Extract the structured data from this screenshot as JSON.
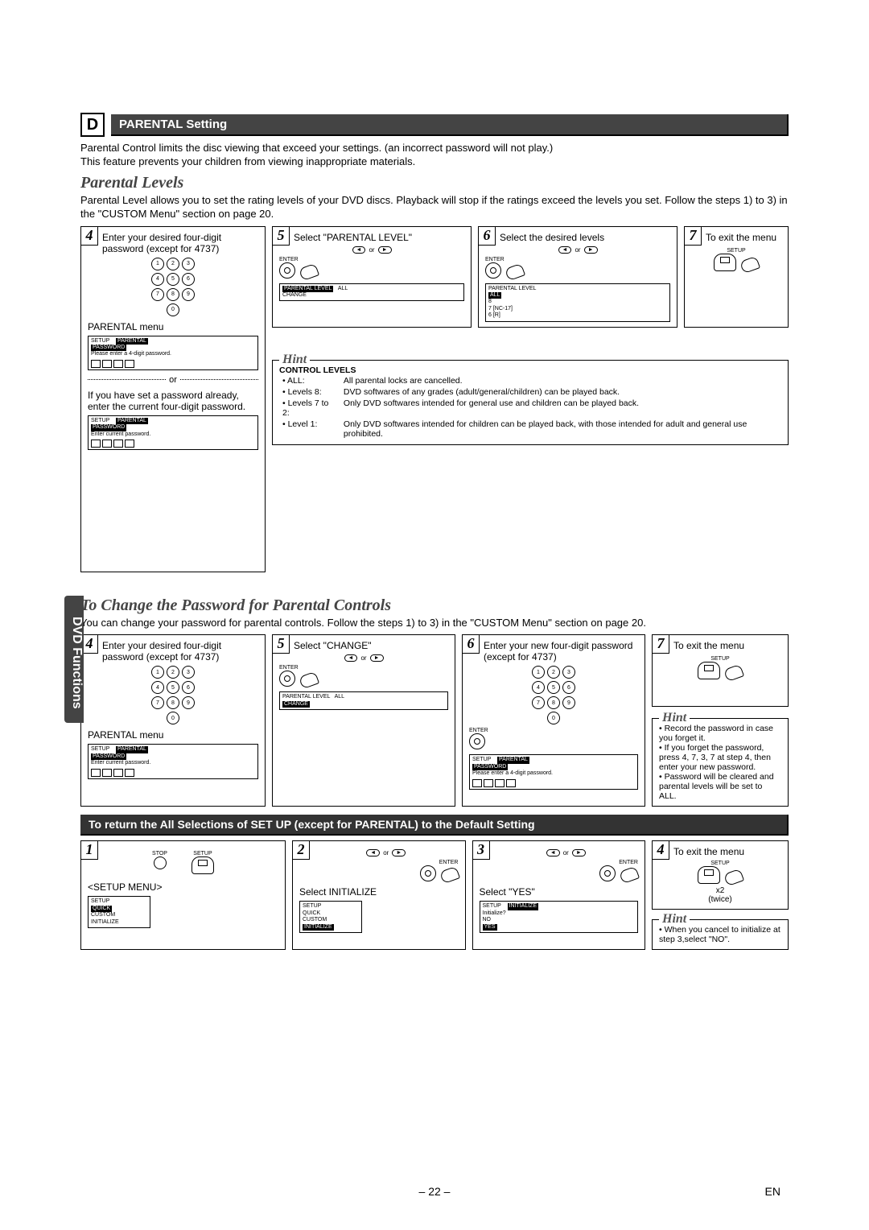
{
  "section": {
    "letter": "D",
    "title": "PARENTAL Setting"
  },
  "intro1": "Parental Control limits the disc viewing that exceed your settings. (an incorrect password will not play.)",
  "intro2": "This feature prevents your children from viewing inappropriate materials.",
  "sub1": "Parental Levels",
  "sub1_desc": "Parental Level allows you to set the rating levels of your DVD discs. Playback will stop if the ratings exceed the levels you set. Follow the steps 1) to 3) in the \"CUSTOM Menu\" section on page 20.",
  "step4": {
    "num": "4",
    "text": "Enter your desired four-digit password (except for 4737)",
    "menu_label": "PARENTAL menu",
    "osd": {
      "setup": "SETUP",
      "parental": "PARENTAL",
      "password": "PASSWORD",
      "prompt": "Please enter a 4-digit password."
    },
    "or": "or",
    "if_set": "If you have set a password already, enter the current four-digit password.",
    "osd2_prompt": "Enter current password."
  },
  "step5": {
    "num": "5",
    "text": "Select \"PARENTAL LEVEL\"",
    "or": "or",
    "osd": {
      "level": "PARENTAL LEVEL",
      "all": "ALL",
      "change": "CHANGE"
    }
  },
  "step6": {
    "num": "6",
    "text": "Select the desired levels",
    "or": "or",
    "osd": {
      "level": "PARENTAL LEVEL",
      "all": "ALL",
      "l8": "8",
      "l7": "7 [NC-17]",
      "l6": "6 [R]"
    }
  },
  "step7": {
    "num": "7",
    "text": "To exit the menu",
    "setup_lbl": "SETUP"
  },
  "hint1": {
    "title": "Hint",
    "heading": "CONTROL LEVELS",
    "rows": [
      {
        "lbl": "• ALL:",
        "desc": "All parental locks are cancelled."
      },
      {
        "lbl": "• Levels 8:",
        "desc": "DVD softwares of any grades (adult/general/children) can be played back."
      },
      {
        "lbl": "• Levels 7 to 2:",
        "desc": "Only DVD softwares intended for general use and children can be played back."
      },
      {
        "lbl": "• Level 1:",
        "desc": "Only DVD softwares intended for children can be played back, with those intended for adult and general use prohibited."
      }
    ]
  },
  "sub2": "To Change the Password for Parental Controls",
  "sub2_desc": "You can change your password for parental controls.  Follow the steps 1) to 3) in the \"CUSTOM Menu\" section on page 20.",
  "c_step4": {
    "num": "4",
    "text": "Enter your desired four-digit password (except for 4737)",
    "menu_label": "PARENTAL menu",
    "osd": {
      "setup": "SETUP",
      "parental": "PARENTAL",
      "password": "PASSWORD",
      "prompt": "Enter current password."
    }
  },
  "c_step5": {
    "num": "5",
    "text": "Select \"CHANGE\"",
    "or": "or",
    "osd": {
      "level": "PARENTAL LEVEL",
      "all": "ALL",
      "change": "CHANGE"
    }
  },
  "c_step6": {
    "num": "6",
    "text": "Enter your new four-digit password (except for 4737)",
    "osd": {
      "setup": "SETUP",
      "parental": "PARENTAL",
      "password": "PASSWORD",
      "prompt": "Please enter a 4-digit password."
    }
  },
  "c_step7": {
    "num": "7",
    "text": "To exit the menu",
    "setup_lbl": "SETUP"
  },
  "hint2": {
    "title": "Hint",
    "items": [
      "Record the password in case you forget it.",
      "If you forget the password, press 4, 7, 3, 7 at step 4, then enter your new password.",
      "Password will be cleared and parental levels will be set to ALL."
    ]
  },
  "return_bar": "To return the All Selections of SET UP (except for PARENTAL) to the Default Setting",
  "r_step1": {
    "num": "1",
    "setup_menu": "<SETUP MENU>",
    "stop": "STOP",
    "setup": "SETUP",
    "osd": {
      "setup": "SETUP",
      "quick": "QUICK",
      "custom": "CUSTOM",
      "init": "INITIALIZE"
    }
  },
  "r_step2": {
    "num": "2",
    "or": "or",
    "select": "Select INITIALIZE",
    "osd": {
      "setup": "SETUP",
      "quick": "QUICK",
      "custom": "CUSTOM",
      "init": "INITIALIZE"
    }
  },
  "r_step3": {
    "num": "3",
    "or": "or",
    "select": "Select \"YES\"",
    "osd": {
      "setup": "SETUP",
      "init": "INITIALIZE",
      "q": "Initialize?",
      "no": "NO",
      "yes": "YES"
    }
  },
  "r_step4": {
    "num": "4",
    "text": "To exit the menu",
    "setup_lbl": "SETUP",
    "x2": "x2",
    "twice": "(twice)"
  },
  "hint3": {
    "title": "Hint",
    "text": "When you cancel to initialize at step 3,select \"NO\"."
  },
  "enter_lbl": "ENTER",
  "sidebar": "DVD Functions",
  "page_num": "– 22 –",
  "lang": "EN"
}
